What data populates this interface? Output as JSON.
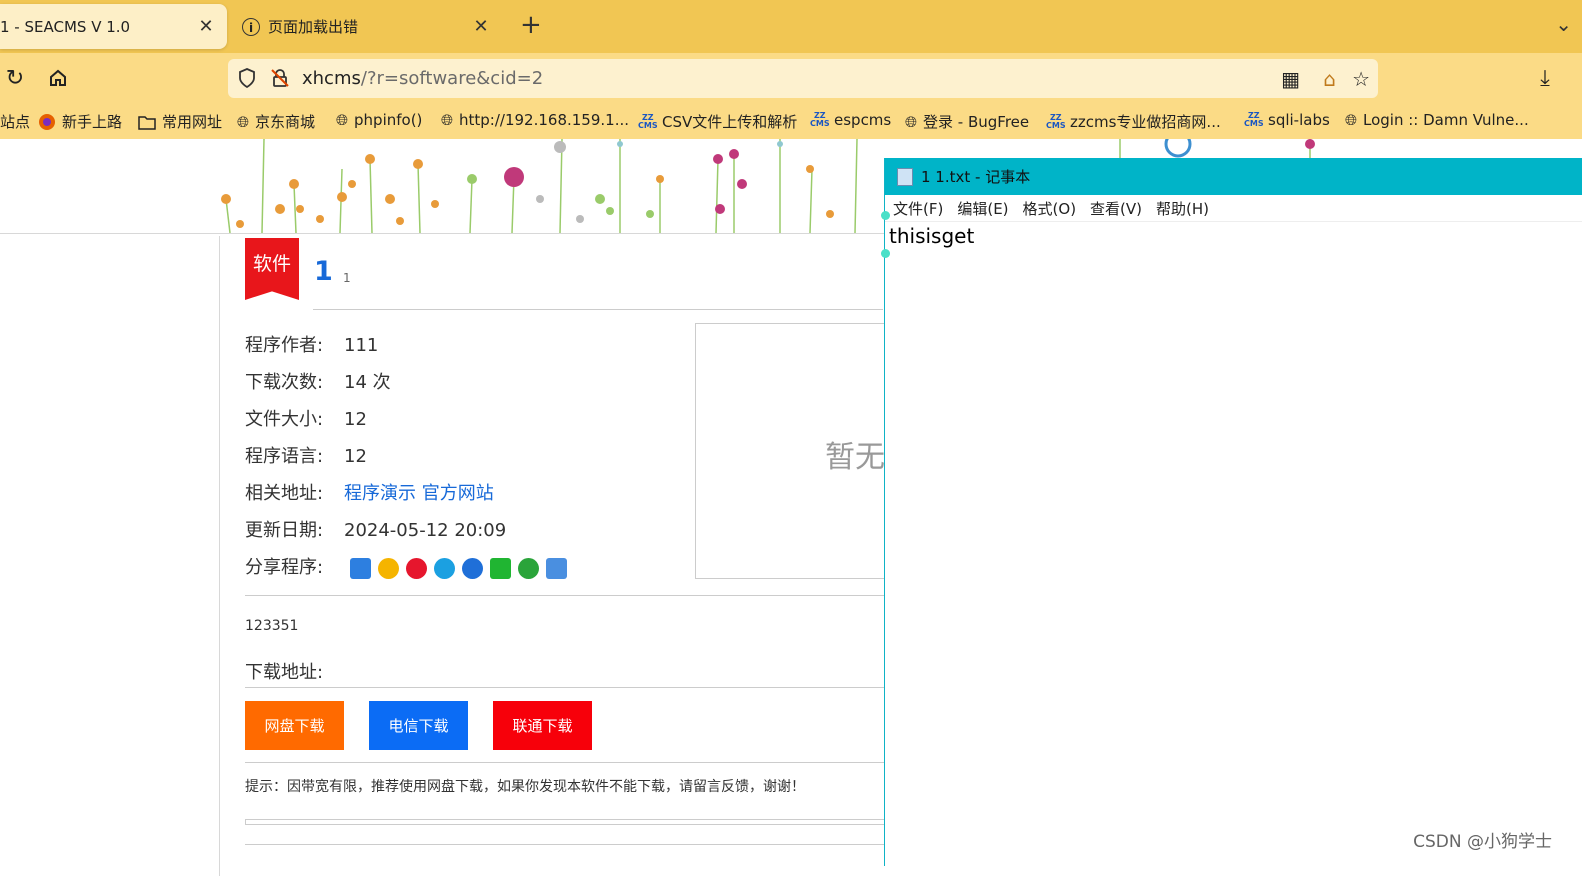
{
  "browser": {
    "tabs": [
      {
        "title": "1 - SEACMS V 1.0",
        "active": true
      },
      {
        "title": "页面加载出错",
        "active": false
      }
    ],
    "url_host": "xhcms",
    "url_path": "/?r=software&cid=2",
    "bookmarks": [
      {
        "label": "站点",
        "icon": "none"
      },
      {
        "label": "新手上路",
        "icon": "firefox-icon"
      },
      {
        "label": "常用网址",
        "icon": "folder-icon"
      },
      {
        "label": "京东商城",
        "icon": "globe-icon"
      },
      {
        "label": "phpinfo()",
        "icon": "globe-icon"
      },
      {
        "label": "http://192.168.159.1...",
        "icon": "globe-icon"
      },
      {
        "label": "CSV文件上传和解析",
        "icon": "zzcms-icon"
      },
      {
        "label": "espcms",
        "icon": "zzcms-icon"
      },
      {
        "label": "登录 - BugFree",
        "icon": "globe-icon"
      },
      {
        "label": "zzcms专业做招商网...",
        "icon": "zzcms-icon"
      },
      {
        "label": "sqli-labs",
        "icon": "zzcms-icon"
      },
      {
        "label": "Login :: Damn Vulne...",
        "icon": "globe-icon"
      }
    ]
  },
  "page": {
    "ribbon": "软件",
    "software_name": "1",
    "software_version": "1",
    "info": [
      {
        "label": "程序作者:",
        "value": "111"
      },
      {
        "label": "下载次数:",
        "value": "14 次"
      },
      {
        "label": "文件大小:",
        "value": "12"
      },
      {
        "label": "程序语言:",
        "value": "12"
      },
      {
        "label": "相关地址:",
        "link1": "程序演示",
        "link2": "官方网站"
      },
      {
        "label": "更新日期:",
        "value": "2024-05-12 20:09"
      },
      {
        "label": "分享程序:"
      }
    ],
    "image_placeholder": "暂无",
    "description": "123351",
    "download_label": "下载地址:",
    "buttons": {
      "pan": "网盘下载",
      "telecom": "电信下载",
      "unicom": "联通下载"
    },
    "tip": "提示：因带宽有限，推荐使用网盘下载，如果你发现本软件不能下载，请留言反馈，谢谢！"
  },
  "notepad": {
    "title": "1 1.txt - 记事本",
    "menu": [
      "文件(F)",
      "编辑(E)",
      "格式(O)",
      "查看(V)",
      "帮助(H)"
    ],
    "text": "thisisget"
  },
  "watermark": "CSDN @小狗学士",
  "colors": {
    "pan_button": "#ff6a00",
    "telecom_button": "#0b6cf5",
    "unicom_button": "#f7000a",
    "ribbon": "#e8161b",
    "notepad_titlebar": "#00b4c8"
  }
}
